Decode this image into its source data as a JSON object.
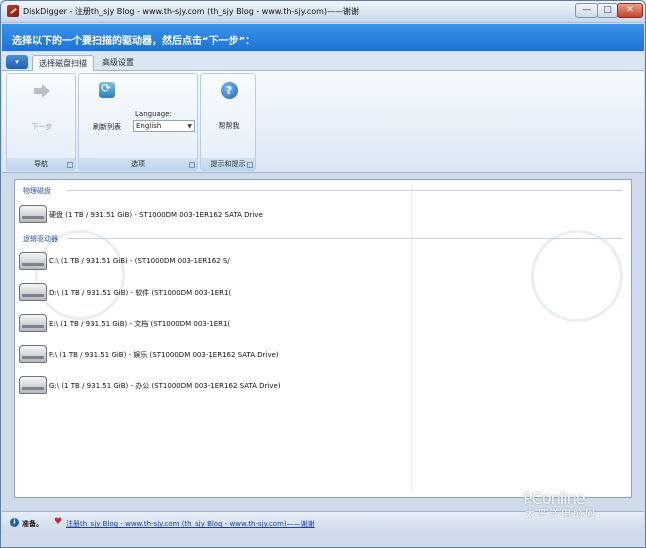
{
  "window": {
    "title": "DiskDigger - 注册th_sjy Blog - www.th-sjy.com (th_sjy Blog - www.th-sjy.com)——谢谢",
    "min_glyph": "—",
    "max_glyph": "□",
    "close_glyph": "✕"
  },
  "banner": {
    "text": "选择以下的一个要扫描的驱动器，然后点击“下一步”："
  },
  "ribbon": {
    "app_menu_glyph": "▾",
    "tabs": [
      {
        "label": "选择磁盘扫描",
        "active": true
      },
      {
        "label": "高级设置",
        "active": false
      }
    ],
    "groups": {
      "navigation": {
        "label": "导航",
        "next_label": "下一步"
      },
      "options": {
        "label": "选项",
        "refresh_label": "刷新列表",
        "language_label": "Language:",
        "language_value": "English"
      },
      "help": {
        "label": "提示和提示",
        "help_label": "帮帮我",
        "help_glyph": "?"
      }
    }
  },
  "content": {
    "physical": {
      "label": "物理磁盘",
      "drives": [
        {
          "label": "硬盘 (1 TB / 931.51 GiB) - ST1000DM 003-1ER162 SATA Drive"
        }
      ]
    },
    "logical": {
      "label": "逻辑驱动器",
      "drives": [
        {
          "label": "C:\\ (1 TB / 931.51 GiB) -  (ST1000DM 003-1ER162 S/"
        },
        {
          "label": "D:\\ (1 TB / 931.51 GiB) - 软件 (ST1000DM 003-1ER1("
        },
        {
          "label": "E:\\ (1 TB / 931.51 GiB) - 文档 (ST1000DM 003-1ER1("
        },
        {
          "label": "F:\\ (1 TB / 931.51 GiB) - 娱乐 (ST1000DM 003-1ER162 SATA Drive)"
        },
        {
          "label": "G:\\ (1 TB / 931.51 GiB) - 办公 (ST1000DM 003-1ER162 SATA Drive)"
        }
      ]
    }
  },
  "status": {
    "text": "准备。",
    "link": "注册th_sjy Blog - www.th-sjy.com (th_sjy Blog - www.th-sjy.com)——谢谢"
  },
  "watermark": {
    "brand": "PConline",
    "sub": "太平洋电脑网"
  }
}
